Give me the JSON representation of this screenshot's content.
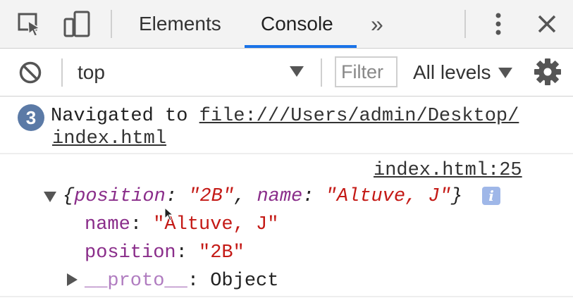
{
  "tabs": {
    "items": [
      {
        "label": "Elements"
      },
      {
        "label": "Console"
      }
    ],
    "more_label": "»"
  },
  "toolbar": {
    "context": "top",
    "filter_placeholder": "Filter",
    "levels": "All levels"
  },
  "console": {
    "navigation": {
      "count": "3",
      "text": "Navigated to ",
      "url_line1": "file:///Users/admin/Desktop/",
      "url_line2": "index.html"
    },
    "log": {
      "source": "index.html:25",
      "summary_open": "{",
      "summary_key1": "position",
      "summary_colon1": ": ",
      "summary_val1": "\"2B\"",
      "summary_comma": ", ",
      "summary_key2": "name",
      "summary_colon2": ": ",
      "summary_val2": "\"Altuve, J\"",
      "summary_close": "}",
      "info": "i",
      "props": [
        {
          "key": "name",
          "value": "\"Altuve, J\""
        },
        {
          "key": "position",
          "value": "\"2B\""
        },
        {
          "key": "__proto__",
          "value": "Object"
        }
      ]
    }
  },
  "colors": {
    "accent": "#1a73e8",
    "key": "#8a2d8a",
    "string": "#c41a16",
    "badge": "#5b7aa6"
  },
  "icons": [
    "inspect-icon",
    "device-toggle-icon",
    "kebab-menu-icon",
    "close-icon",
    "clear-console-icon",
    "dropdown-arrow-icon",
    "settings-gear-icon",
    "expand-triangle-icon",
    "collapse-triangle-icon",
    "info-icon"
  ]
}
